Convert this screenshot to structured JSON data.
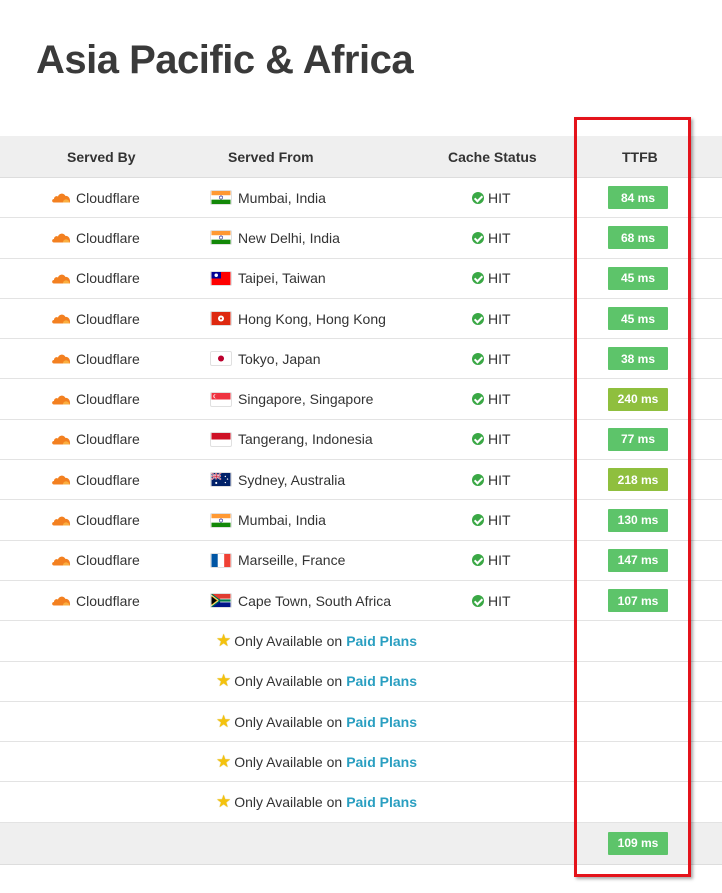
{
  "page": {
    "title": "Asia Pacific & Africa"
  },
  "table": {
    "headers": {
      "served_by": "Served By",
      "served_from": "Served From",
      "cache_status": "Cache Status",
      "ttfb": "TTFB"
    },
    "rows": [
      {
        "provider": "Cloudflare",
        "location": "Mumbai, India",
        "flag": "india-flag",
        "status": "HIT",
        "ttfb": "84 ms",
        "ttfb_color": "#5dc46a"
      },
      {
        "provider": "Cloudflare",
        "location": "New Delhi, India",
        "flag": "india-flag",
        "status": "HIT",
        "ttfb": "68 ms",
        "ttfb_color": "#5dc46a"
      },
      {
        "provider": "Cloudflare",
        "location": "Taipei, Taiwan",
        "flag": "taiwan-flag",
        "status": "HIT",
        "ttfb": "45 ms",
        "ttfb_color": "#5dc46a"
      },
      {
        "provider": "Cloudflare",
        "location": "Hong Kong, Hong Kong",
        "flag": "hong-kong-flag",
        "status": "HIT",
        "ttfb": "45 ms",
        "ttfb_color": "#5dc46a"
      },
      {
        "provider": "Cloudflare",
        "location": "Tokyo, Japan",
        "flag": "japan-flag",
        "status": "HIT",
        "ttfb": "38 ms",
        "ttfb_color": "#5dc46a"
      },
      {
        "provider": "Cloudflare",
        "location": "Singapore, Singapore",
        "flag": "singapore-flag",
        "status": "HIT",
        "ttfb": "240 ms",
        "ttfb_color": "#8fbf3e"
      },
      {
        "provider": "Cloudflare",
        "location": "Tangerang, Indonesia",
        "flag": "indonesia-flag",
        "status": "HIT",
        "ttfb": "77 ms",
        "ttfb_color": "#5dc46a"
      },
      {
        "provider": "Cloudflare",
        "location": "Sydney, Australia",
        "flag": "australia-flag",
        "status": "HIT",
        "ttfb": "218 ms",
        "ttfb_color": "#8fbf3e"
      },
      {
        "provider": "Cloudflare",
        "location": "Mumbai, India",
        "flag": "india-flag",
        "status": "HIT",
        "ttfb": "130 ms",
        "ttfb_color": "#5dc46a"
      },
      {
        "provider": "Cloudflare",
        "location": "Marseille, France",
        "flag": "france-flag",
        "status": "HIT",
        "ttfb": "147 ms",
        "ttfb_color": "#5dc46a"
      },
      {
        "provider": "Cloudflare",
        "location": "Cape Town, South Africa",
        "flag": "south-africa-flag",
        "status": "HIT",
        "ttfb": "107 ms",
        "ttfb_color": "#5dc46a"
      }
    ],
    "paid_rows": [
      {
        "text": "Only Available on",
        "link": "Paid Plans",
        "icon": "star-icon"
      },
      {
        "text": "Only Available on",
        "link": "Paid Plans",
        "icon": "star-icon"
      },
      {
        "text": "Only Available on",
        "link": "Paid Plans",
        "icon": "star-icon"
      },
      {
        "text": "Only Available on",
        "link": "Paid Plans",
        "icon": "star-icon"
      },
      {
        "text": "Only Available on",
        "link": "Paid Plans",
        "icon": "star-icon"
      }
    ],
    "footer": {
      "average_ttfb": "109 ms",
      "average_color": "#5dc46a"
    }
  },
  "colors": {
    "highlight": "#e4131b",
    "cloudflare_orange": "#f38020",
    "link": "#2a9fc1",
    "check": "#3aa845"
  }
}
